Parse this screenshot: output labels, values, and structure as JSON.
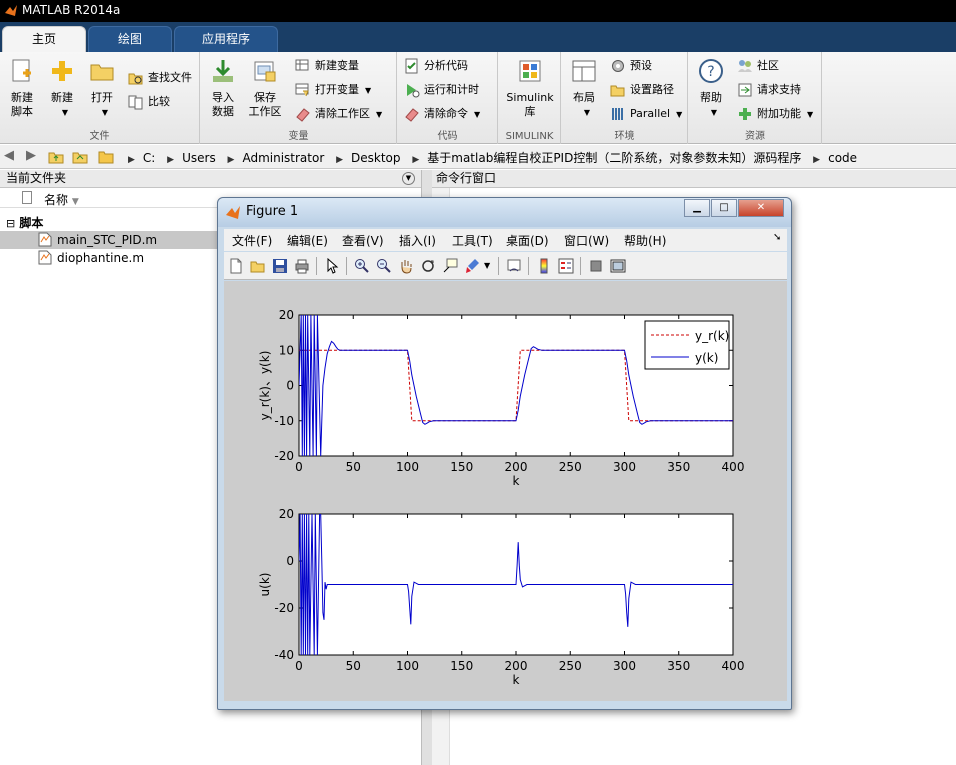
{
  "app": {
    "title": "MATLAB R2014a"
  },
  "tabs": [
    {
      "label": "主页",
      "active": true
    },
    {
      "label": "绘图",
      "active": false
    },
    {
      "label": "应用程序",
      "active": false
    }
  ],
  "ribbon": {
    "file": {
      "label": "文件",
      "new_script": "新建\n脚本",
      "new": "新建",
      "open": "打开",
      "find_files": "查找文件",
      "compare": "比较"
    },
    "variable": {
      "label": "变量",
      "import": "导入\n数据",
      "save_ws": "保存\n工作区",
      "new_var": "新建变量",
      "open_var": "打开变量",
      "clear_ws": "清除工作区"
    },
    "code": {
      "label": "代码",
      "analyze": "分析代码",
      "run_time": "运行和计时",
      "clear_cmd": "清除命令"
    },
    "simulink": {
      "label": "SIMULINK",
      "lib": "Simulink\n库"
    },
    "env": {
      "label": "环境",
      "layout": "布局",
      "prefs": "预设",
      "set_path": "设置路径",
      "parallel": "Parallel"
    },
    "resources": {
      "label": "资源",
      "help": "帮助",
      "community": "社区",
      "support": "请求支持",
      "addons": "附加功能"
    }
  },
  "address": {
    "crumbs": [
      "C:",
      "Users",
      "Administrator",
      "Desktop",
      "基于matlab编程自校正PID控制（二阶系统，对象参数未知）源码程序",
      "code"
    ]
  },
  "file_panel": {
    "title": "当前文件夹",
    "col_name": "名称",
    "group": "脚本",
    "files": [
      "main_STC_PID.m",
      "diophantine.m"
    ]
  },
  "cmd_panel": {
    "title": "命令行窗口"
  },
  "figure": {
    "title": "Figure 1",
    "menus": [
      "文件(F)",
      "编辑(E)",
      "查看(V)",
      "插入(I)",
      "工具(T)",
      "桌面(D)",
      "窗口(W)",
      "帮助(H)"
    ]
  },
  "colors": {
    "ref": "#cc0000",
    "out": "#0000cc",
    "ribbon_accent": "#1a3e66"
  },
  "chart_data": [
    {
      "type": "line",
      "xlabel": "k",
      "ylabel": "y_r(k)、y(k)",
      "xlim": [
        0,
        400
      ],
      "ylim": [
        -20,
        20
      ],
      "xticks": [
        0,
        50,
        100,
        150,
        200,
        250,
        300,
        350,
        400
      ],
      "yticks": [
        20,
        10,
        0,
        -10,
        -20
      ],
      "legend_position": "top-right",
      "series": [
        {
          "name": "y_r(k)",
          "style": "dashed",
          "color": "#cc0000",
          "x": [
            0,
            100,
            104,
            200,
            204,
            300,
            304,
            400
          ],
          "y": [
            10,
            10,
            -10,
            -10,
            10,
            10,
            -10,
            -10
          ]
        },
        {
          "name": "y(k)",
          "style": "solid",
          "color": "#0000cc",
          "x": [
            0,
            2,
            3,
            4,
            5,
            6,
            7,
            8,
            10,
            11,
            13,
            14,
            16,
            17,
            20,
            22,
            24,
            26,
            28,
            30,
            32,
            34,
            36,
            38,
            40,
            45,
            100,
            102,
            104,
            108,
            112,
            114,
            116,
            118,
            120,
            124,
            130,
            200,
            202,
            204,
            208,
            212,
            214,
            216,
            218,
            220,
            224,
            230,
            300,
            302,
            304,
            308,
            312,
            314,
            316,
            318,
            320,
            324,
            330,
            400
          ],
          "y": [
            0,
            20,
            -20,
            20,
            -20,
            20,
            -20,
            20,
            -20,
            20,
            -20,
            20,
            -20,
            20,
            -20,
            0,
            5,
            9,
            11,
            12.5,
            12,
            11,
            10.2,
            10,
            10,
            10,
            10,
            7,
            3,
            -3,
            -8,
            -10.5,
            -11,
            -10.7,
            -10.3,
            -10,
            -10,
            -10,
            -7,
            -3,
            3,
            8,
            10.5,
            11,
            10.7,
            10.3,
            10,
            10,
            10,
            7,
            3,
            -3,
            -8,
            -10.5,
            -11,
            -10.7,
            -10.3,
            -10,
            -10,
            -10
          ]
        }
      ]
    },
    {
      "type": "line",
      "xlabel": "k",
      "ylabel": "u(k)",
      "xlim": [
        0,
        400
      ],
      "ylim": [
        -40,
        20
      ],
      "xticks": [
        0,
        50,
        100,
        150,
        200,
        250,
        300,
        350,
        400
      ],
      "yticks": [
        20,
        0,
        -20,
        -40
      ],
      "series": [
        {
          "color": "#0000cc",
          "x": [
            0,
            1,
            2,
            3,
            4,
            5,
            6,
            7,
            8,
            9,
            10,
            12,
            14,
            15,
            17,
            19,
            20,
            21,
            22,
            23,
            24,
            25,
            26,
            27,
            28,
            30,
            100,
            101,
            102,
            103,
            104,
            106,
            110,
            114,
            120,
            200,
            201,
            202,
            203,
            204,
            206,
            210,
            214,
            220,
            300,
            301,
            302,
            303,
            304,
            306,
            310,
            314,
            320,
            400
          ],
          "y": [
            0,
            20,
            -40,
            20,
            -40,
            20,
            -40,
            20,
            -40,
            20,
            -40,
            20,
            -40,
            20,
            -40,
            20,
            20,
            0,
            -22,
            -25,
            -9,
            -12,
            -10,
            -10,
            -10,
            -10,
            -10,
            -13,
            -20,
            -27,
            -15,
            -9,
            -10,
            -10,
            -10,
            -10,
            -2,
            8,
            -2,
            -8,
            -11,
            -10,
            -10,
            -10,
            -10,
            -14,
            -22,
            -28,
            -16,
            -9,
            -10,
            -10,
            -10,
            -10
          ]
        }
      ]
    }
  ]
}
